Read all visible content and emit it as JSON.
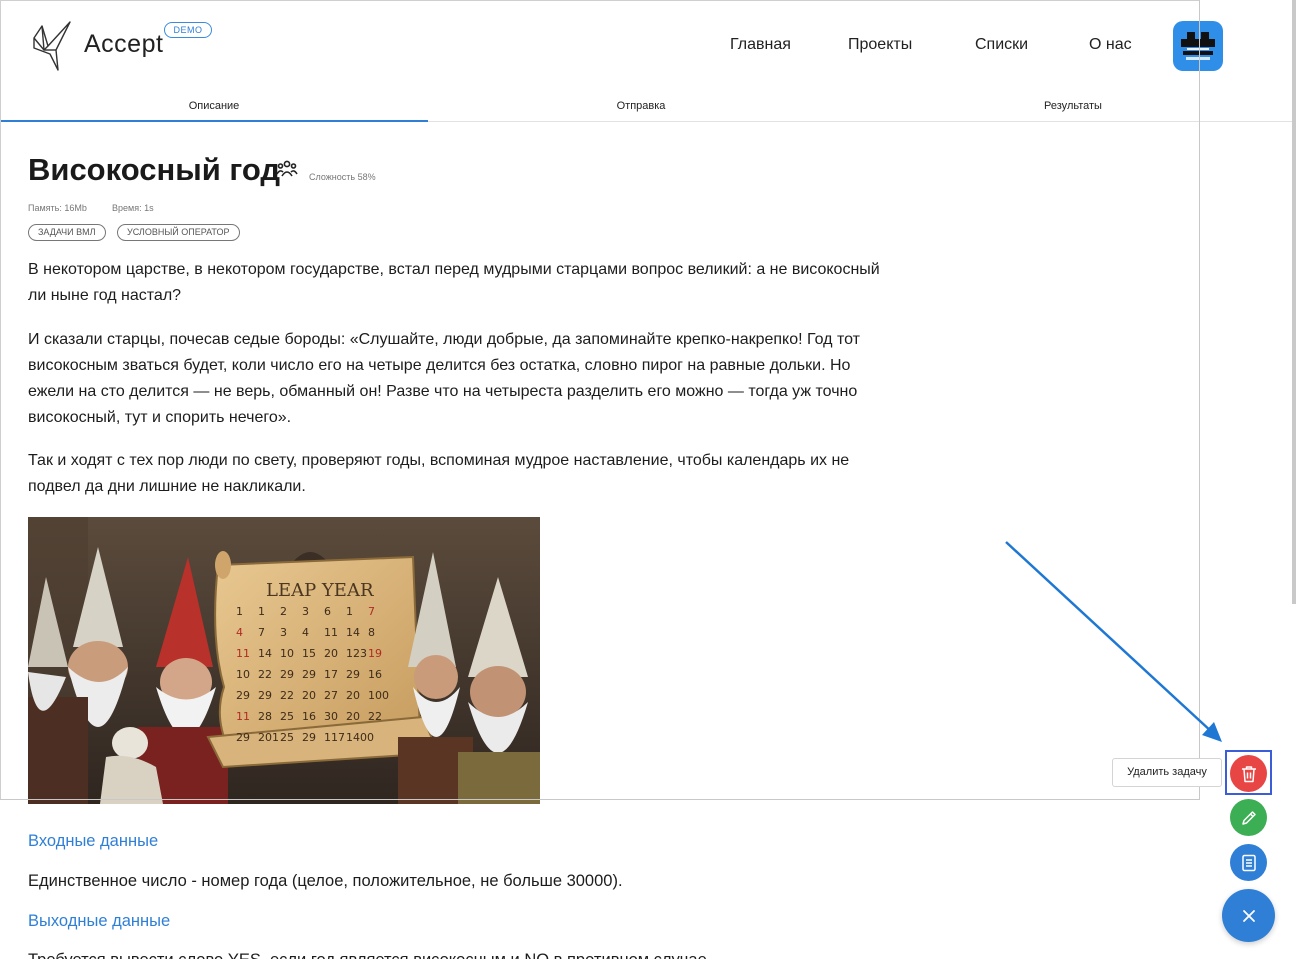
{
  "brand": {
    "name": "Accept",
    "badge": "DEMO"
  },
  "nav": {
    "items": [
      "Главная",
      "Проекты",
      "Списки",
      "О нас"
    ]
  },
  "tabs": [
    "Описание",
    "Отправка",
    "Результаты"
  ],
  "task": {
    "title": "Високосный год",
    "difficulty": "Сложность 58%",
    "memory": "Память: 16Mb",
    "time": "Время: 1s",
    "tags": [
      "ЗАДАЧИ ВМЛ",
      "УСЛОВНЫЙ ОПЕРАТОР"
    ],
    "paragraphs": [
      "В некотором царстве, в некотором государстве, встал перед мудрыми старцами вопрос великий: а не високосный ли ныне год настал?",
      "И сказали старцы, почесав седые бороды: «Слушайте, люди добрые, да запоминайте крепко-накрепко! Год тот високосным зваться будет, коли число его на четыре делится без остатка, словно пирог на равные дольки. Но ежели на сто делится — не верь, обманный он! Разве что на четыреста разделить его можно — тогда уж точно високосный, тут и спорить нечего».",
      "Так и ходят с тех пор люди по свету, проверяют годы, вспоминая мудрое наставление, чтобы календарь их не подвел да дни лишние не накликали."
    ],
    "illustration": {
      "scroll_title": "LEAP YEAR",
      "rows": [
        [
          "1",
          "1",
          "2",
          "3",
          "6",
          "1",
          "7"
        ],
        [
          "4",
          "7",
          "3",
          "4",
          "11",
          "14",
          "8"
        ],
        [
          "11",
          "14",
          "10",
          "15",
          "20",
          "123",
          "19"
        ],
        [
          "10",
          "22",
          "29",
          "29",
          "17",
          "29",
          "16"
        ],
        [
          "29",
          "29",
          "22",
          "20",
          "27",
          "20",
          "100"
        ],
        [
          "11",
          "28",
          "25",
          "16",
          "30",
          "20",
          "22"
        ],
        [
          "29",
          "201",
          "25",
          "29",
          "117",
          "1400",
          ""
        ]
      ]
    },
    "input_title": "Входные данные",
    "input_text": "Единственное число - номер года (целое, положительное, не больше 30000).",
    "output_title": "Выходные данные",
    "output_text": "Требуется вывести слово YES, если год является високосным и NO в противном случае."
  },
  "fab": {
    "delete_tooltip": "Удалить задачу"
  },
  "colors": {
    "accent": "#2f7fd6",
    "delete": "#e84545",
    "edit": "#3cae54",
    "highlight": "#3b5ed8"
  }
}
